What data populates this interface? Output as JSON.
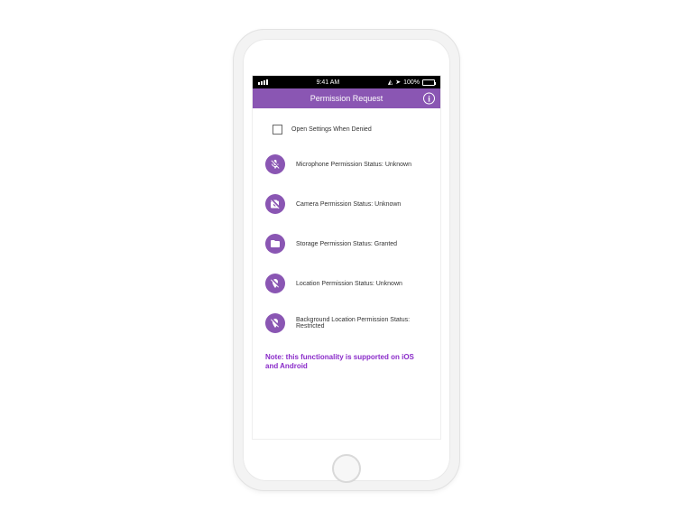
{
  "status_bar": {
    "time": "9:41 AM",
    "battery_pct": "100%"
  },
  "app_bar": {
    "title": "Permission Request"
  },
  "checkbox": {
    "label": "Open Settings When Denied",
    "checked": false
  },
  "permissions": [
    {
      "icon": "microphone-off-icon",
      "label": "Microphone Permission Status: Unknown"
    },
    {
      "icon": "camera-off-icon",
      "label": "Camera Permission Status: Unknown"
    },
    {
      "icon": "folder-icon",
      "label": "Storage Permission Status: Granted"
    },
    {
      "icon": "location-off-icon",
      "label": "Location Permission Status: Unknown"
    },
    {
      "icon": "location-off-icon",
      "label": "Background Location Permission Status: Restricted"
    }
  ],
  "note": "Note: this functionality is supported on iOS and Android",
  "colors": {
    "accent": "#8a56b3"
  }
}
